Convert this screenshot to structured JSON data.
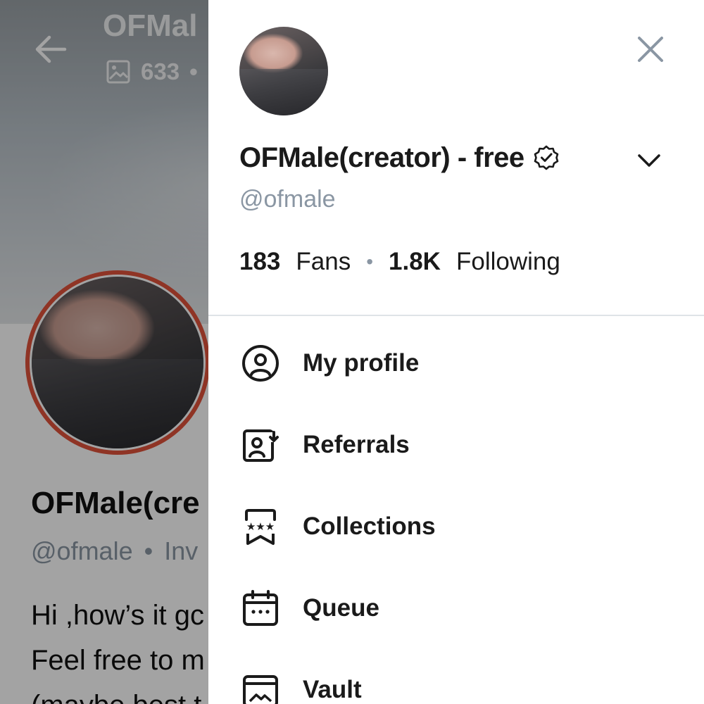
{
  "background": {
    "title": "OFMal",
    "media_count": "633",
    "profile_name": "OFMale(cre",
    "handle": "@ofmale",
    "handle_suffix": "Inv",
    "bio_lines": [
      "Hi ,how’s it gc",
      "Feel free to m",
      "(maybe best t"
    ]
  },
  "drawer": {
    "display_name": "OFMale(creator) - free",
    "handle": "@ofmale",
    "fans_count": "183",
    "fans_label": "Fans",
    "following_count": "1.8K",
    "following_label": "Following",
    "menu": [
      {
        "label": "My profile",
        "icon": "user-circle-icon"
      },
      {
        "label": "Referrals",
        "icon": "referral-icon"
      },
      {
        "label": "Collections",
        "icon": "collections-icon"
      },
      {
        "label": "Queue",
        "icon": "calendar-icon"
      },
      {
        "label": "Vault",
        "icon": "vault-icon"
      }
    ]
  },
  "colors": {
    "accent_ring": "#e0523a",
    "muted_text": "#8a96a3",
    "icon_gray": "#8a96a3",
    "text": "#1a1a1a"
  }
}
